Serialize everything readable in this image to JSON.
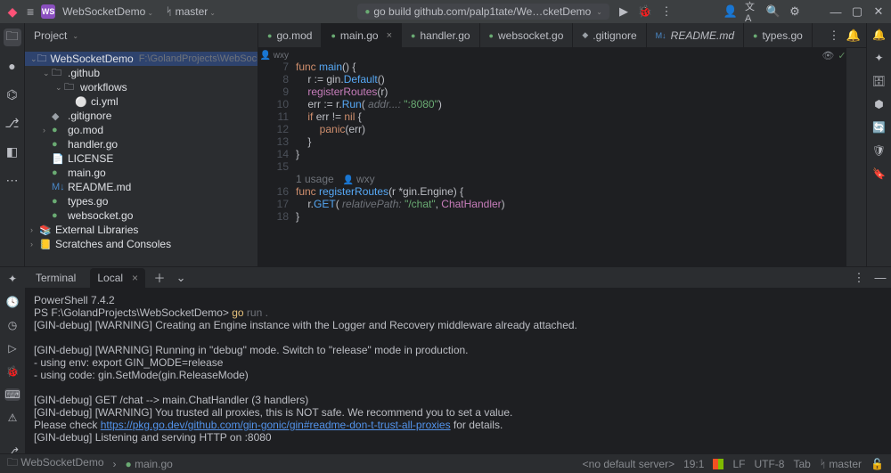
{
  "titlebar": {
    "project": "WebSocketDemo",
    "branch": "master",
    "runConfig": "go build github.com/palp1tate/We…cketDemo"
  },
  "projectPanel": {
    "title": "Project",
    "root": {
      "label": "WebSocketDemo",
      "path": "F:\\GolandProjects\\WebSocketDemo"
    },
    "nodes": {
      "github": ".github",
      "workflows": "workflows",
      "ci": "ci.yml",
      "gitignore": ".gitignore",
      "gomod": "go.mod",
      "handler": "handler.go",
      "license": "LICENSE",
      "maingo": "main.go",
      "readme": "README.md",
      "types": "types.go",
      "websocket": "websocket.go",
      "extlib": "External Libraries",
      "scratch": "Scratches and Consoles"
    }
  },
  "tabs": {
    "gomod": "go.mod",
    "main": "main.go",
    "handler": "handler.go",
    "websocket": "websocket.go",
    "gitignore": ".gitignore",
    "readme": "README.md",
    "types": "types.go"
  },
  "breadcrumb": {
    "pkg": "wxy"
  },
  "code": {
    "l7a": "func ",
    "l7b": "main",
    "l7c": "() {",
    "l8a": "    r := gin.",
    "l8b": "Default",
    "l8c": "()",
    "l9a": "    ",
    "l9b": "registerRoutes",
    "l9c": "(r)",
    "l10a": "    err := r.",
    "l10b": "Run",
    "l10c": "( ",
    "l10hint": "addr...: ",
    "l10d": "\":8080\"",
    "l10e": ")",
    "l11a": "    ",
    "l11b": "if ",
    "l11c": "err != ",
    "l11d": "nil",
    "l11e": " {",
    "l12a": "        ",
    "l12b": "panic",
    "l12c": "(err)",
    "l13": "    }",
    "l14": "}",
    "l15": "",
    "usage": "1 usage   ",
    "author": "wxy",
    "l16a": "func ",
    "l16b": "registerRoutes",
    "l16c": "(r *gin.Engine) {",
    "l17a": "    r.",
    "l17b": "GET",
    "l17c": "( ",
    "l17hint": "relativePath: ",
    "l17d": "\"/chat\"",
    "l17e": ", ",
    "l17f": "ChatHandler",
    "l17g": ")",
    "l18": "}"
  },
  "gutter": {
    "7": "7",
    "8": "8",
    "9": "9",
    "10": "10",
    "11": "11",
    "12": "12",
    "13": "13",
    "14": "14",
    "15": "15",
    "16": "16",
    "17": "17",
    "18": "18"
  },
  "terminal": {
    "title": "Terminal",
    "localTab": "Local",
    "lines": {
      "ps": "PowerShell 7.4.2",
      "prompt": "PS F:\\GolandProjects\\WebSocketDemo> ",
      "cmd": "go ",
      "cmdGray": "run .",
      "warn1": "[GIN-debug] [WARNING] Creating an Engine instance with the Logger and Recovery middleware already attached.",
      "warn2": "[GIN-debug] [WARNING] Running in \"debug\" mode. Switch to \"release\" mode in production.",
      "env": " - using env:   export GIN_MODE=release",
      "code": " - using code:  gin.SetMode(gin.ReleaseMode)",
      "route": "[GIN-debug] GET    /chat                     --> main.ChatHandler (3 handlers)",
      "proxy": "[GIN-debug] [WARNING] You trusted all proxies, this is NOT safe. We recommend you to set a value.",
      "check": "Please check ",
      "link": "https://pkg.go.dev/github.com/gin-gonic/gin#readme-don-t-trust-all-proxies",
      "details": " for details.",
      "listen": "[GIN-debug] Listening and serving HTTP on :8080"
    }
  },
  "statusbar": {
    "bc1": "WebSocketDemo",
    "bc2": "main.go",
    "server": "<no default server>",
    "pos": "19:1",
    "lf": "LF",
    "enc": "UTF-8",
    "indent": "Tab",
    "branch": "master"
  }
}
